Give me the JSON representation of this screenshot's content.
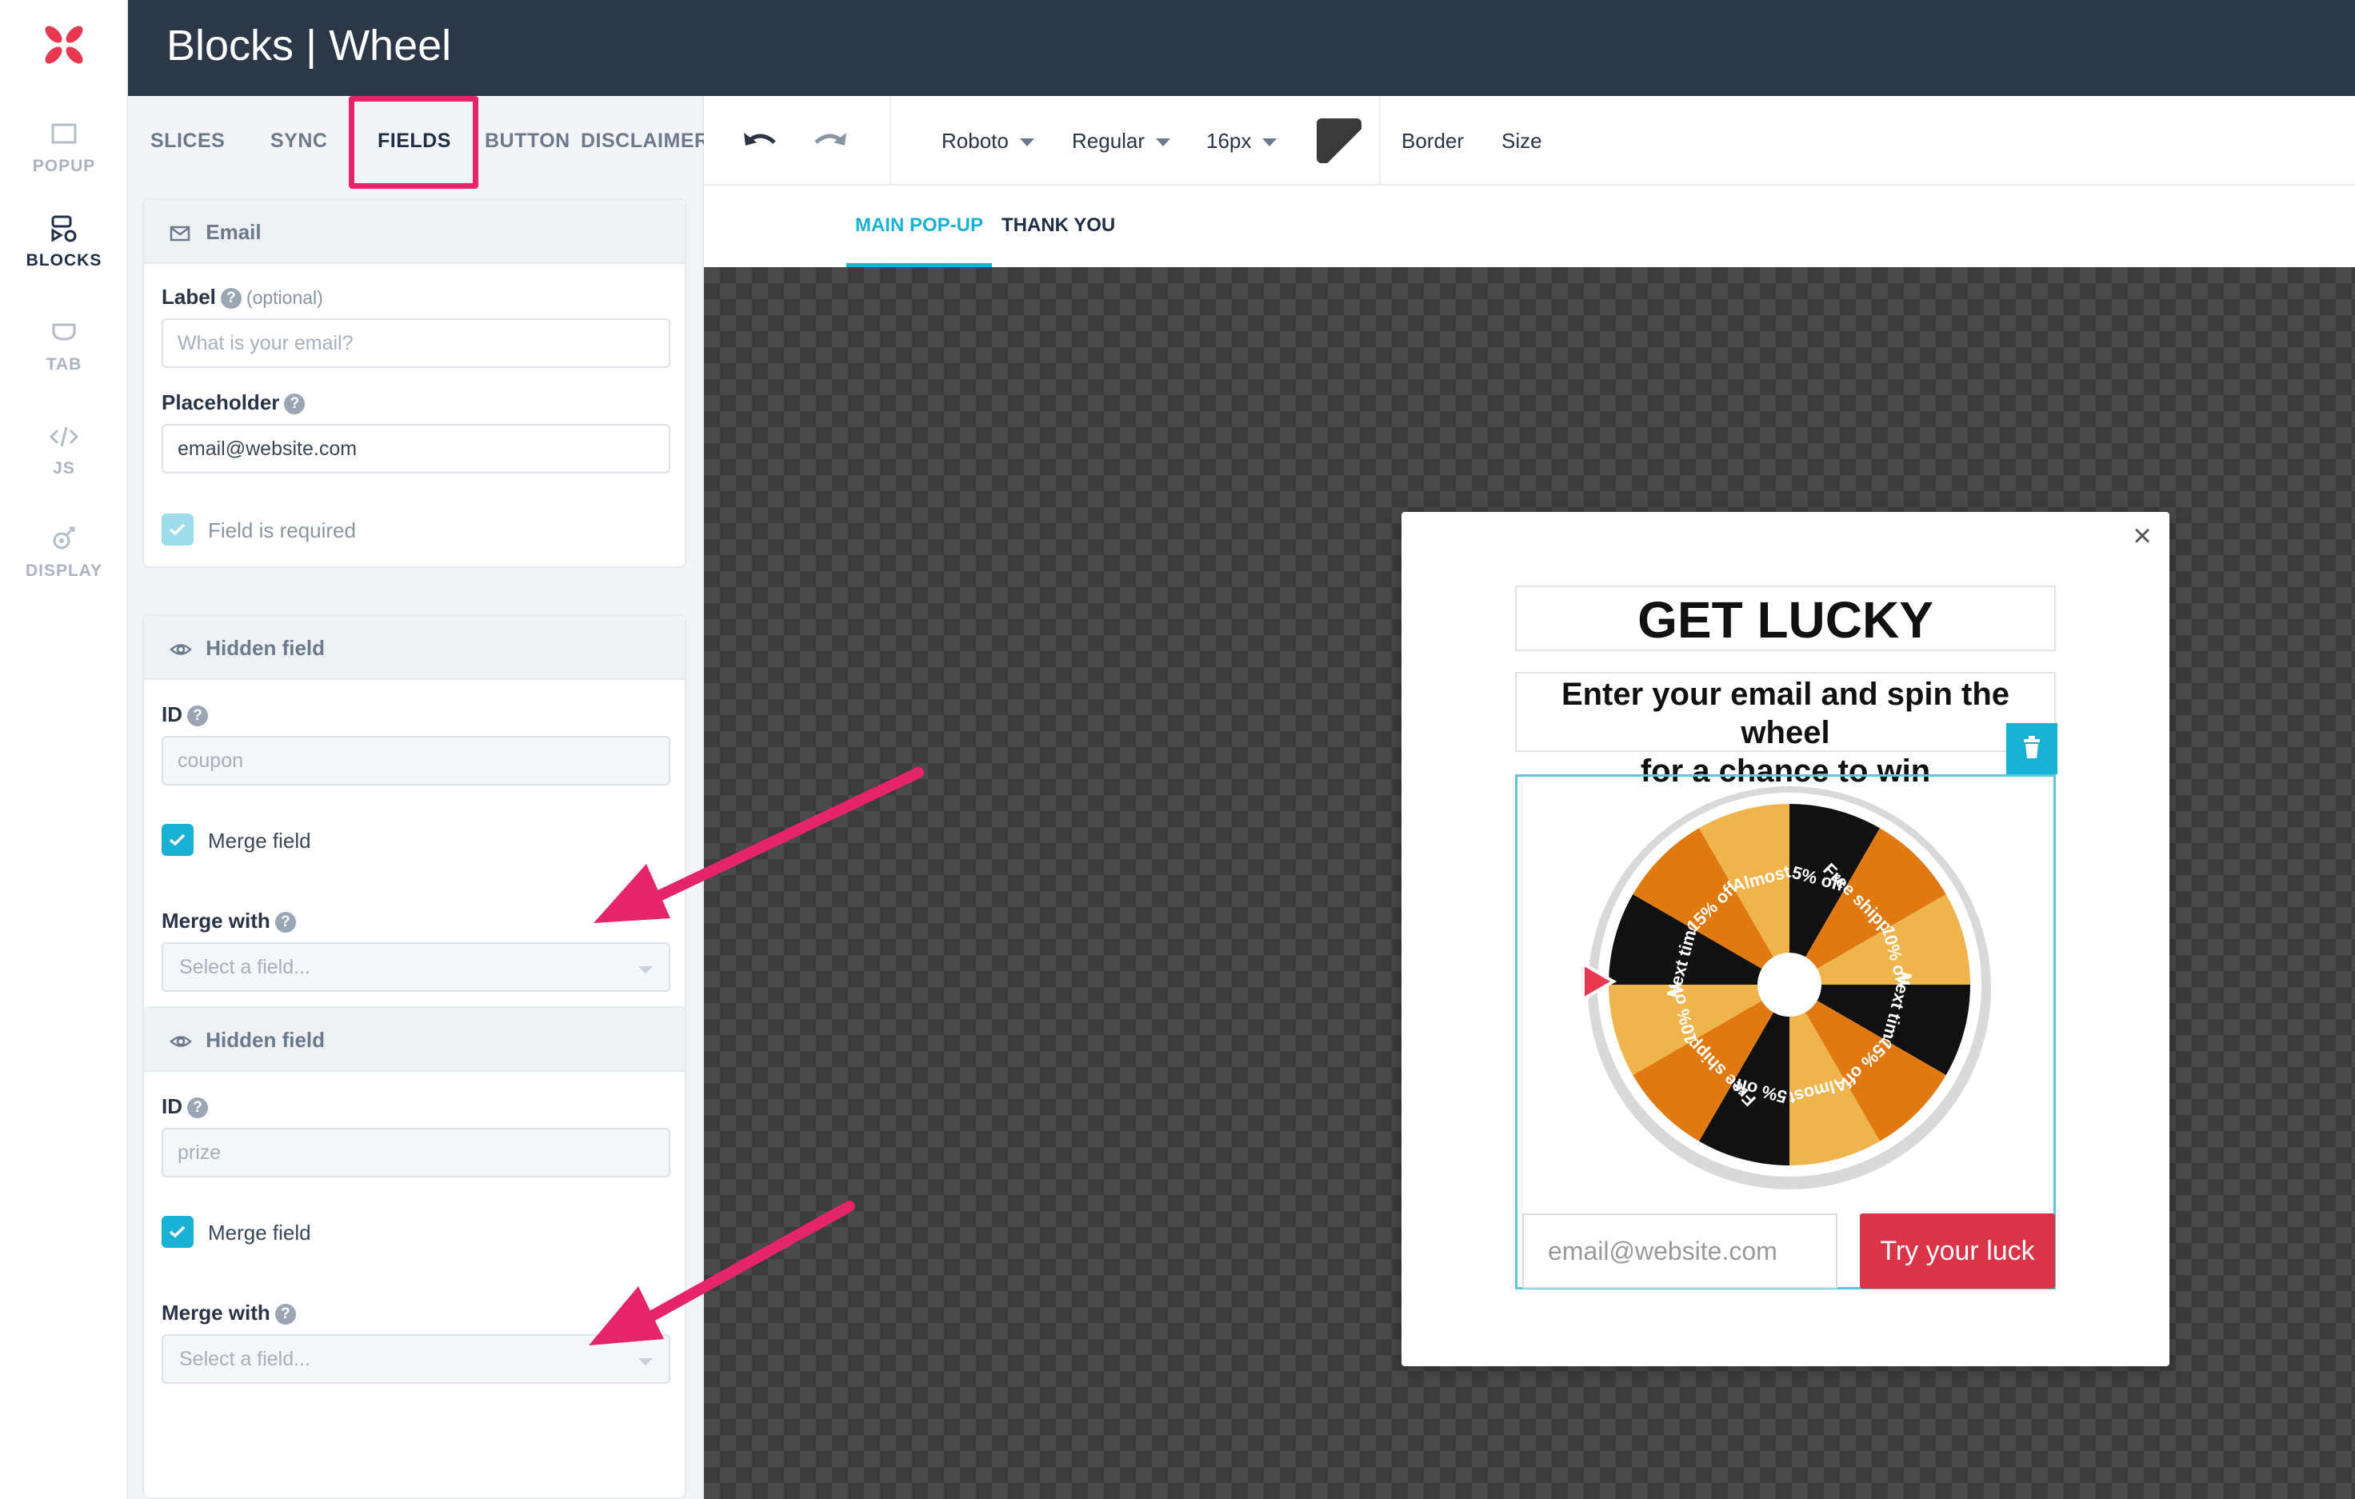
{
  "window": {
    "title": "Blocks | Wheel"
  },
  "rail": {
    "items": [
      {
        "label": "POPUP",
        "icon": "popup-icon"
      },
      {
        "label": "BLOCKS",
        "icon": "blocks-icon"
      },
      {
        "label": "TAB",
        "icon": "tab-icon"
      },
      {
        "label": "JS",
        "icon": "code-icon"
      },
      {
        "label": "DISPLAY",
        "icon": "display-icon"
      }
    ],
    "active": "BLOCKS"
  },
  "panel": {
    "tabs": [
      {
        "label": "SLICES"
      },
      {
        "label": "SYNC"
      },
      {
        "label": "FIELDS"
      },
      {
        "label": "BUTTON"
      },
      {
        "label": "DISCLAIMER"
      }
    ],
    "active_tab": "FIELDS",
    "email": {
      "header": "Email",
      "label_title": "Label",
      "label_optional": "(optional)",
      "label_placeholder": "What is your email?",
      "placeholder_title": "Placeholder",
      "placeholder_value": "email@website.com",
      "required_label": "Field is required",
      "required_checked": true
    },
    "hidden1": {
      "header": "Hidden field",
      "id_title": "ID",
      "id_value": "coupon",
      "merge_label": "Merge field",
      "merge_checked": true,
      "merge_with_title": "Merge with",
      "merge_with_placeholder": "Select a field..."
    },
    "hidden2": {
      "header": "Hidden field",
      "id_title": "ID",
      "id_value": "prize",
      "merge_label": "Merge field",
      "merge_checked": true,
      "merge_with_title": "Merge with",
      "merge_with_placeholder": "Select a field..."
    },
    "help_glyph": "?"
  },
  "toolbar": {
    "font": "Roboto",
    "weight": "Regular",
    "size": "16px",
    "color": "#3a3a3a",
    "border_label": "Border",
    "size_label": "Size"
  },
  "page_tabs": {
    "main": "MAIN POP-UP",
    "thanks": "THANK YOU",
    "active": "MAIN POP-UP"
  },
  "popup": {
    "close": "×",
    "title": "GET LUCKY",
    "subtitle_line1": "Enter your email and spin the wheel",
    "subtitle_line2": "for a chance to win",
    "email_placeholder": "email@website.com",
    "button": "Try your luck",
    "wheel": {
      "slices": [
        {
          "label": "5% off",
          "color": "#111111"
        },
        {
          "label": "Free shipping",
          "color": "#e07a10"
        },
        {
          "label": "10% off",
          "color": "#f0b44c"
        },
        {
          "label": "Next time!",
          "color": "#111111"
        },
        {
          "label": "15% off",
          "color": "#e07a10"
        },
        {
          "label": "Almost",
          "color": "#f0b44c"
        },
        {
          "label": "5% off",
          "color": "#111111"
        },
        {
          "label": "Free shipping",
          "color": "#e07a10"
        },
        {
          "label": "10% off",
          "color": "#f0b44c"
        },
        {
          "label": "Next time!",
          "color": "#111111"
        },
        {
          "label": "15% off",
          "color": "#e07a10"
        },
        {
          "label": "Almost",
          "color": "#f0b44c"
        }
      ]
    }
  },
  "colors": {
    "accent": "#1ab2d4",
    "highlight": "#e5246a",
    "button": "#d93448",
    "titlebar": "#2c3848"
  }
}
